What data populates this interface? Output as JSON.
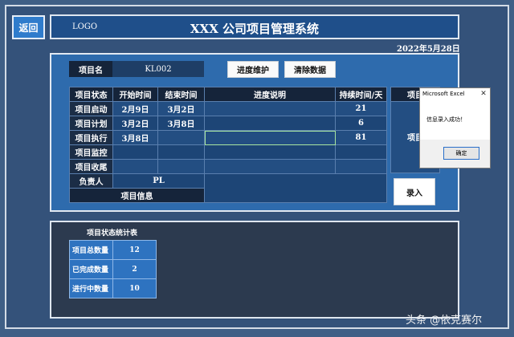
{
  "back_button": "返回",
  "header": {
    "logo": "LOGO",
    "title": "XXX 公司项目管理系统"
  },
  "date": "2022年5月28日",
  "project": {
    "label": "项目名",
    "value": "KL002"
  },
  "buttons": {
    "progress": "进度维护",
    "clear": "清除数据",
    "submit": "录入"
  },
  "table": {
    "headers": [
      "项目状态",
      "开始时间",
      "结束时间",
      "进度说明",
      "持续时间/天"
    ],
    "side_header": "项目",
    "side_text": "项目",
    "rows": [
      {
        "state": "项目启动",
        "start": "2月9日",
        "end": "3月2日",
        "desc": "",
        "days": "21"
      },
      {
        "state": "项目计划",
        "start": "3月2日",
        "end": "3月8日",
        "desc": "",
        "days": "6"
      },
      {
        "state": "项目执行",
        "start": "3月8日",
        "end": "",
        "desc": "",
        "days": "81"
      },
      {
        "state": "项目监控",
        "start": "",
        "end": "",
        "desc": "",
        "days": ""
      },
      {
        "state": "项目收尾",
        "start": "",
        "end": "",
        "desc": "",
        "days": ""
      }
    ],
    "owner_label": "负责人",
    "owner_value": "PL",
    "info_label": "项目信息"
  },
  "stats": {
    "title": "项目状态统计表",
    "rows": [
      {
        "label": "项目总数量",
        "value": "12"
      },
      {
        "label": "已完成数量",
        "value": "2"
      },
      {
        "label": "进行中数量",
        "value": "10"
      }
    ]
  },
  "dialog": {
    "title": "Microsoft Excel",
    "message": "信息录入成功！",
    "ok": "确定",
    "close_glyph": "✕"
  },
  "watermark": "头条 @依克赛尔"
}
